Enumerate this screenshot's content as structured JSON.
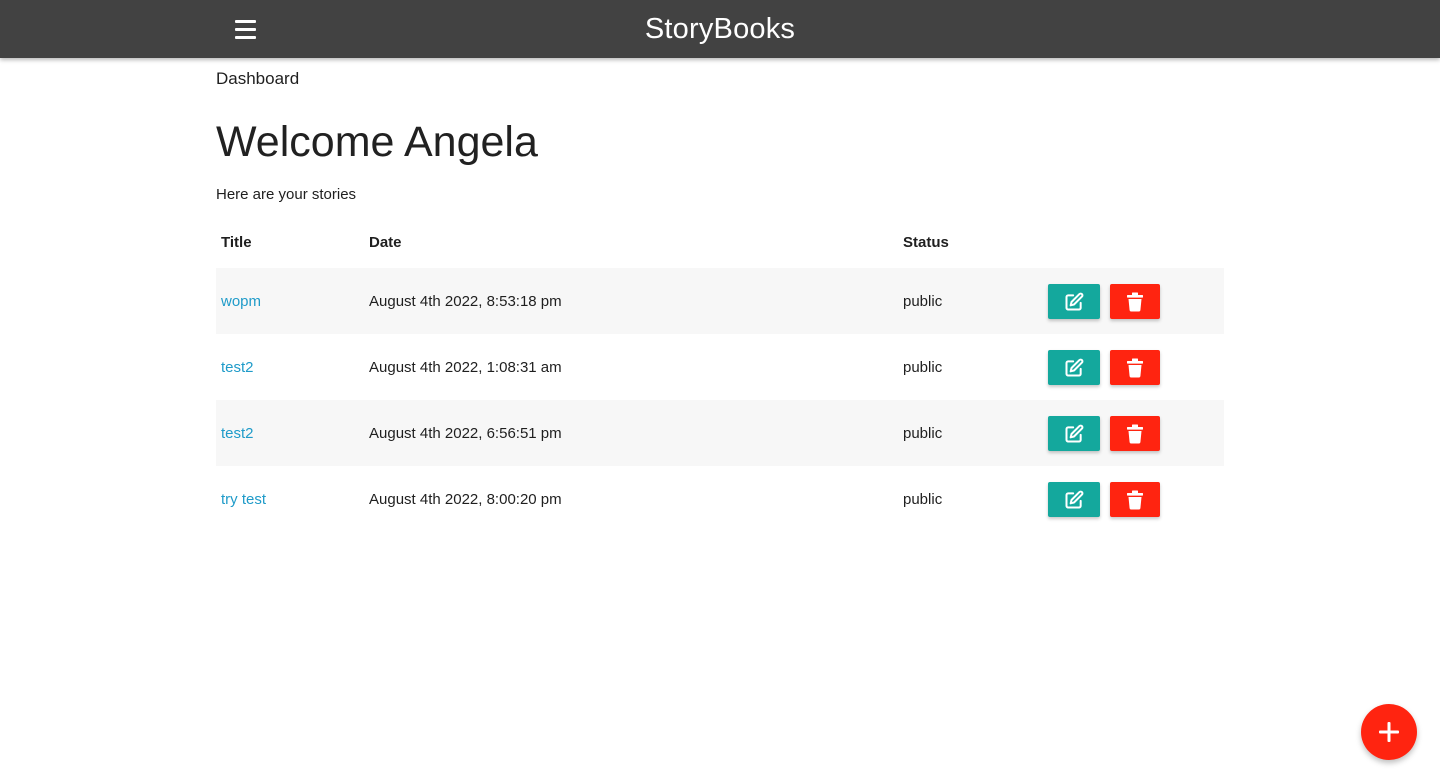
{
  "nav": {
    "brand": "StoryBooks",
    "menu_icon": "hamburger-menu-icon",
    "bg_color": "#424242"
  },
  "page": {
    "breadcrumb": "Dashboard",
    "heading": "Welcome Angela",
    "subheading": "Here are your stories"
  },
  "table": {
    "headers": {
      "title": "Title",
      "date": "Date",
      "status": "Status"
    },
    "rows": [
      {
        "title": "wopm",
        "date": "August 4th 2022, 8:53:18 pm",
        "status": "public"
      },
      {
        "title": "test2",
        "date": "August 4th 2022, 1:08:31 am",
        "status": "public"
      },
      {
        "title": "test2",
        "date": "August 4th 2022, 6:56:51 pm",
        "status": "public"
      },
      {
        "title": "try test",
        "date": "August 4th 2022, 8:00:20 pm",
        "status": "public"
      }
    ],
    "edit_icon": "edit-icon",
    "delete_icon": "trash-icon"
  },
  "fab": {
    "icon": "plus-icon",
    "color": "#ff2410"
  },
  "colors": {
    "link": "#1f9bc9",
    "edit": "#14a89d",
    "delete": "#ff2410"
  }
}
